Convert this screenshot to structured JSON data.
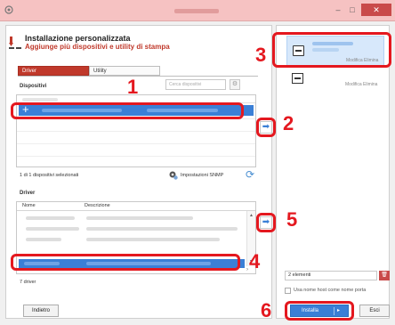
{
  "window": {
    "title": "Product Library",
    "buttons": {
      "minimize": "–",
      "maximize": "□",
      "close": "✕"
    }
  },
  "header": {
    "title": "Installazione personalizzata",
    "subtitle": "Aggiunge più dispositivi e utility di stampa"
  },
  "tabs": [
    {
      "label": "Driver",
      "active": true
    },
    {
      "label": "Utility",
      "active": false
    }
  ],
  "devices": {
    "label": "Dispositivi",
    "search_placeholder": "Cerca dispositivi",
    "selection_count": "1 di 1 dispositivi selezionati",
    "snmp_label": "Impostazioni SNMP"
  },
  "drivers": {
    "label": "Driver",
    "columns": [
      "Nome",
      "Descrizione"
    ],
    "count": "7 driver"
  },
  "right_panel": {
    "cards": [
      {
        "actions": "Modifica  Elimina",
        "selected": true
      },
      {
        "actions": "Modifica  Elimina",
        "selected": false
      }
    ],
    "count": "2 elementi",
    "use_hostname": "Usa nome host come nome porta"
  },
  "footer": {
    "back": "Indietro",
    "install": "Installa",
    "exit": "Esci"
  },
  "callouts": [
    "1",
    "2",
    "3",
    "4",
    "5",
    "6"
  ],
  "colors": {
    "accent": "#c0392b",
    "selection": "#3a7fd6",
    "highlight": "#e4181f",
    "titlebar": "#f6c2c2"
  }
}
